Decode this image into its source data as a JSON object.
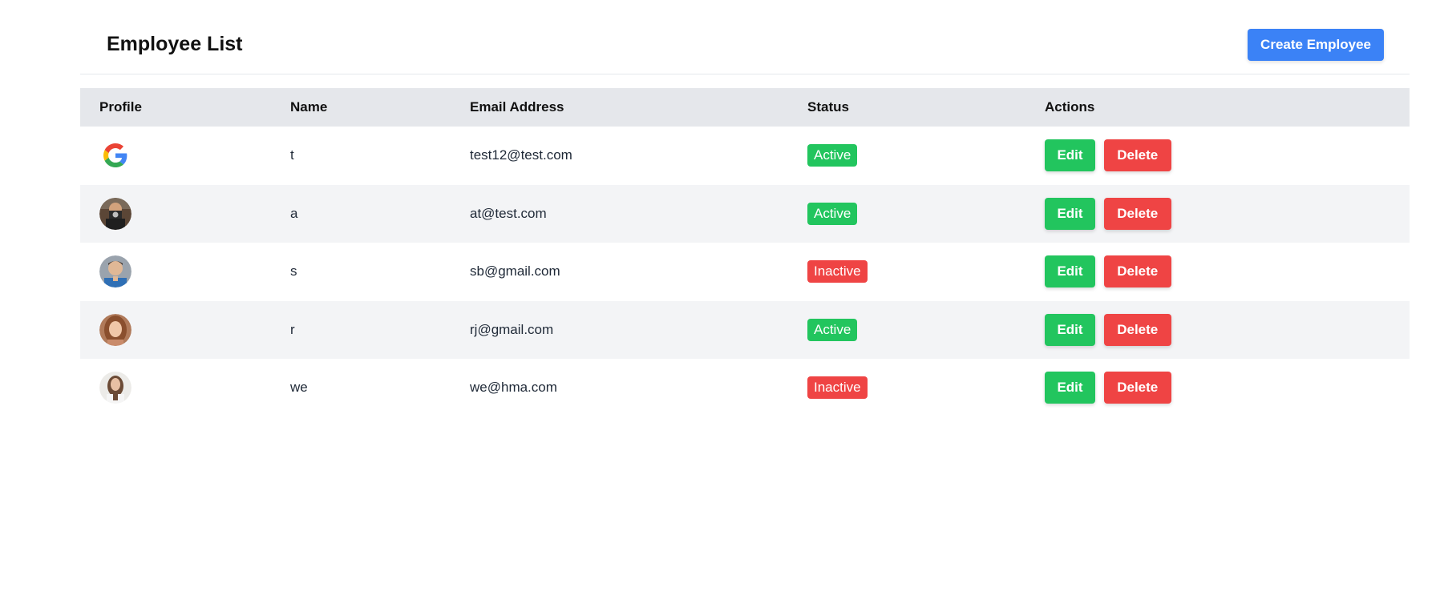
{
  "header": {
    "title": "Employee List",
    "create_label": "Create Employee"
  },
  "table": {
    "columns": [
      "Profile",
      "Name",
      "Email Address",
      "Status",
      "Actions"
    ],
    "rows": [
      {
        "avatar": "google-logo",
        "name": "t",
        "email": "test12@test.com",
        "status": "Active",
        "edit_label": "Edit",
        "delete_label": "Delete"
      },
      {
        "avatar": "person-camera-photo",
        "name": "a",
        "email": "at@test.com",
        "status": "Active",
        "edit_label": "Edit",
        "delete_label": "Delete"
      },
      {
        "avatar": "person-man-photo",
        "name": "s",
        "email": "sb@gmail.com",
        "status": "Inactive",
        "edit_label": "Edit",
        "delete_label": "Delete"
      },
      {
        "avatar": "person-woman-photo",
        "name": "r",
        "email": "rj@gmail.com",
        "status": "Active",
        "edit_label": "Edit",
        "delete_label": "Delete"
      },
      {
        "avatar": "person-woman-photo",
        "name": "we",
        "email": "we@hma.com",
        "status": "Inactive",
        "edit_label": "Edit",
        "delete_label": "Delete"
      }
    ]
  },
  "colors": {
    "primary": "#3b82f6",
    "active": "#22c55e",
    "inactive": "#ef4444",
    "edit": "#22c55e",
    "delete": "#ef4444",
    "header_row": "#e5e7eb",
    "stripe_row": "#f3f4f6"
  }
}
